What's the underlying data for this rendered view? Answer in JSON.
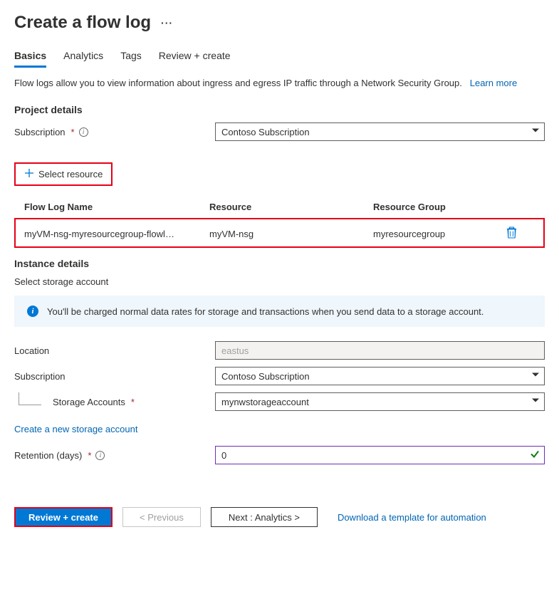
{
  "page_title": "Create a flow log",
  "tabs": {
    "t0": "Basics",
    "t1": "Analytics",
    "t2": "Tags",
    "t3": "Review + create"
  },
  "description": "Flow logs allow you to view information about ingress and egress IP traffic through a Network Security Group.",
  "learn_more": "Learn more",
  "sections": {
    "project_details": "Project details",
    "instance_details": "Instance details",
    "storage_sub": "Select storage account"
  },
  "labels": {
    "subscription": "Subscription",
    "select_resource": "Select resource",
    "flow_log_name": "Flow Log Name",
    "resource": "Resource",
    "resource_group": "Resource Group",
    "location": "Location",
    "storage_accounts": "Storage Accounts",
    "create_storage": "Create a new storage account",
    "retention": "Retention (days)"
  },
  "values": {
    "subscription_top": "Contoso Subscription",
    "row_name": "myVM-nsg-myresourcegroup-flowl…",
    "row_resource": "myVM-nsg",
    "row_rg": "myresourcegroup",
    "location": "eastus",
    "subscription_bottom": "Contoso Subscription",
    "storage_account": "mynwstorageaccount",
    "retention": "0"
  },
  "notice": "You'll be charged normal data rates for storage and transactions when you send data to a storage account.",
  "footer": {
    "review_create": "Review + create",
    "previous": "< Previous",
    "next": "Next : Analytics >",
    "download": "Download a template for automation"
  }
}
